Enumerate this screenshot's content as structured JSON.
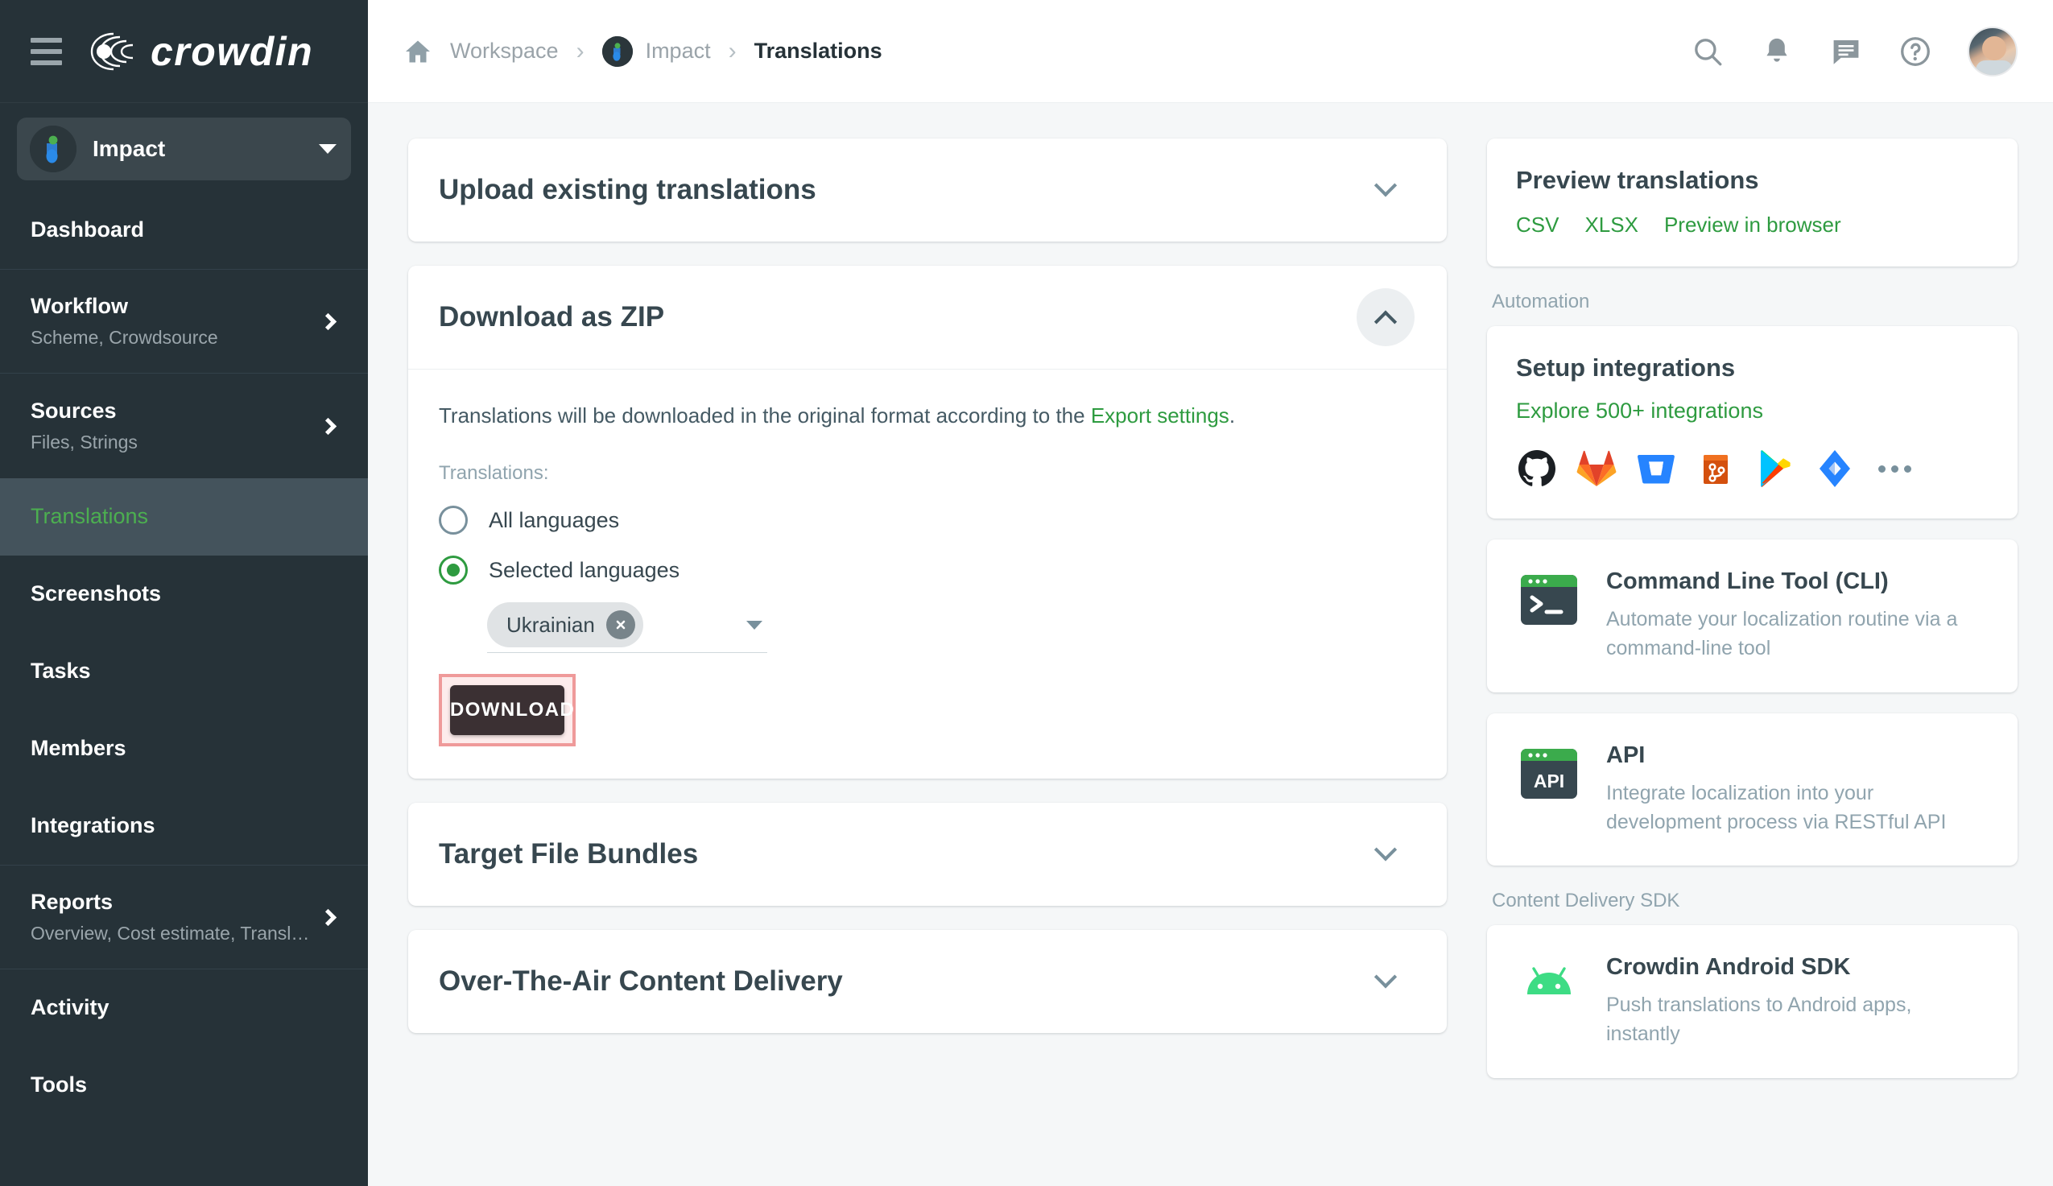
{
  "sidebar": {
    "logo_text": "crowdin",
    "hamburger_icon": "hamburger-menu-icon",
    "project": {
      "name": "Impact",
      "caret_icon": "chevron-down-icon"
    },
    "items": [
      {
        "label": "Dashboard",
        "sub": "",
        "chevron": false,
        "active": false,
        "bordered": false
      },
      {
        "label": "Workflow",
        "sub": "Scheme, Crowdsource",
        "chevron": true,
        "active": false,
        "bordered": true
      },
      {
        "label": "Sources",
        "sub": "Files, Strings",
        "chevron": true,
        "active": false,
        "bordered": false
      },
      {
        "label": "Translations",
        "sub": "",
        "chevron": false,
        "active": true,
        "bordered": false
      },
      {
        "label": "Screenshots",
        "sub": "",
        "chevron": false,
        "active": false,
        "bordered": false
      },
      {
        "label": "Tasks",
        "sub": "",
        "chevron": false,
        "active": false,
        "bordered": false
      },
      {
        "label": "Members",
        "sub": "",
        "chevron": false,
        "active": false,
        "bordered": false
      },
      {
        "label": "Integrations",
        "sub": "",
        "chevron": false,
        "active": false,
        "bordered": false
      },
      {
        "label": "Reports",
        "sub": "Overview, Cost estimate, Transl…",
        "chevron": true,
        "active": false,
        "bordered": true
      },
      {
        "label": "Activity",
        "sub": "",
        "chevron": false,
        "active": false,
        "bordered": false
      },
      {
        "label": "Tools",
        "sub": "",
        "chevron": false,
        "active": false,
        "bordered": false
      }
    ]
  },
  "topbar": {
    "home_icon": "home-icon",
    "breadcrumb": {
      "workspace": "Workspace",
      "project": "Impact",
      "current": "Translations",
      "separator": "›"
    },
    "actions": [
      {
        "name": "search-icon",
        "title": "Search"
      },
      {
        "name": "notifications-bell-icon",
        "title": "Notifications"
      },
      {
        "name": "messages-icon",
        "title": "Messages"
      },
      {
        "name": "help-question-icon",
        "title": "Help"
      }
    ],
    "avatar_name": "user-avatar"
  },
  "main": {
    "accordions": [
      {
        "title": "Upload existing translations",
        "expanded": false,
        "chevron": "chevron-down-icon"
      },
      {
        "title": "Download as ZIP",
        "expanded": true,
        "chevron": "chevron-up-icon"
      },
      {
        "title": "Target File Bundles",
        "expanded": false,
        "chevron": "chevron-down-icon"
      },
      {
        "title": "Over-The-Air Content Delivery",
        "expanded": false,
        "chevron": "chevron-down-icon"
      }
    ],
    "download_zip": {
      "description_before": "Translations will be downloaded in the original format according to the ",
      "description_link": "Export settings",
      "description_after": ".",
      "field_label": "Translations:",
      "radio_all": {
        "label": "All languages",
        "selected": false
      },
      "radio_selected": {
        "label": "Selected languages",
        "selected": true
      },
      "selected_language_chip": "Ukrainian",
      "chip_remove_icon": "close-x-icon",
      "select_caret_icon": "caret-down-icon",
      "download_button": "DOWNLOAD",
      "highlight_color": "#ef9a9a",
      "highlight_fill": "#fdecec",
      "button_color": "#3b3033"
    }
  },
  "right": {
    "preview": {
      "title": "Preview translations",
      "links": [
        "CSV",
        "XLSX",
        "Preview in browser"
      ]
    },
    "automation_caption": "Automation",
    "integrations": {
      "title": "Setup integrations",
      "link": "Explore 500+ integrations",
      "icons": [
        "github-icon",
        "gitlab-icon",
        "bitbucket-icon",
        "aws-codecommit-icon",
        "google-play-icon",
        "jira-icon",
        "more-dots-icon"
      ]
    },
    "cli": {
      "icon": "terminal-prompt-icon",
      "title": "Command Line Tool (CLI)",
      "desc": "Automate your localization routine via a command-line tool"
    },
    "api": {
      "icon": "api-terminal-icon",
      "title": "API",
      "desc": "Integrate localization into your development process via RESTful API"
    },
    "sdk_caption": "Content Delivery SDK",
    "sdk": {
      "icon": "android-robot-icon",
      "title": "Crowdin Android SDK",
      "desc": "Push translations to Android apps, instantly"
    }
  },
  "colors": {
    "sidebar_bg": "#263238",
    "accent_green": "#2e9b40",
    "active_green": "#4caf50",
    "page_bg": "#f5f7f8"
  }
}
